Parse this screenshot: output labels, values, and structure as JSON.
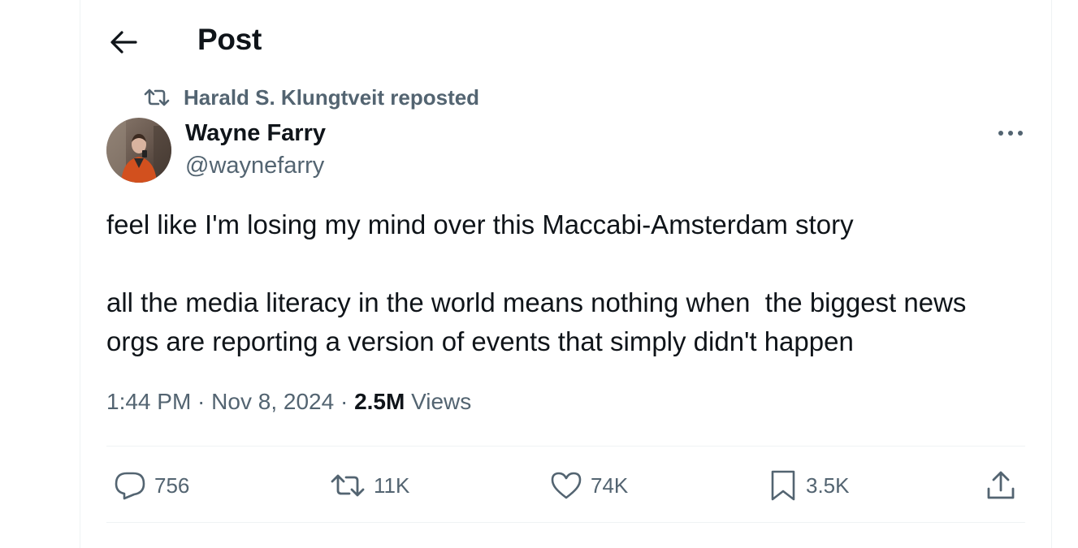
{
  "header": {
    "title": "Post",
    "back_icon": "arrow-left-icon"
  },
  "social_context": {
    "text": "Harald S. Klungtveit reposted",
    "icon": "repost-icon"
  },
  "author": {
    "display_name": "Wayne Farry",
    "handle": "@waynefarry"
  },
  "tweet": {
    "line1": "feel like I'm losing my mind over this Maccabi-Amsterdam story",
    "line2": "all the media literacy in the world means nothing when  the biggest news",
    "line3": "orgs are reporting a version of events that simply didn't happen"
  },
  "meta": {
    "time": "1:44 PM",
    "separator": " · ",
    "date": "Nov 8, 2024",
    "views_count": "2.5M",
    "views_label": " Views"
  },
  "actions": {
    "replies": "756",
    "reposts": "11K",
    "likes": "74K",
    "bookmarks": "3.5K"
  },
  "colors": {
    "text_primary": "#0f1419",
    "text_secondary": "#536471",
    "border": "#eff3f4"
  }
}
